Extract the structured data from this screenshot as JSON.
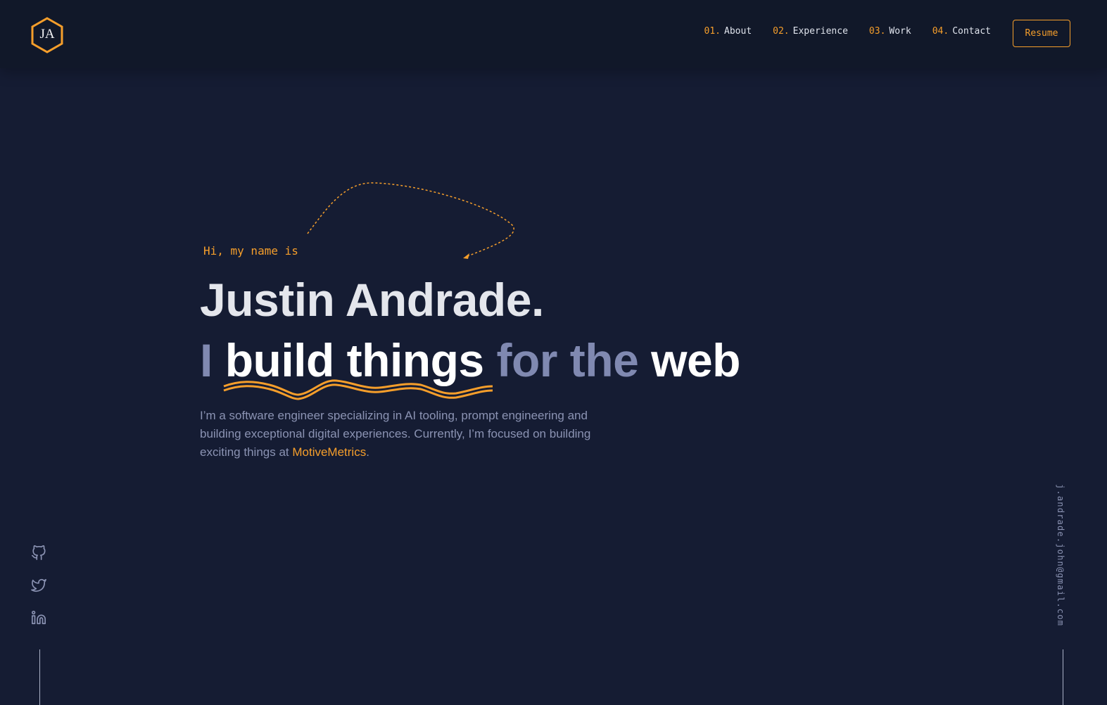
{
  "logo": {
    "initials": "JA"
  },
  "nav": {
    "items": [
      {
        "num": "01.",
        "label": "About"
      },
      {
        "num": "02.",
        "label": "Experience"
      },
      {
        "num": "03.",
        "label": "Work"
      },
      {
        "num": "04.",
        "label": "Contact"
      }
    ],
    "resume_label": "Resume"
  },
  "hero": {
    "greeting": "Hi, my name is",
    "name": "Justin Andrade.",
    "tagline": {
      "part1": "I",
      "part2": "build things",
      "part3": "for the",
      "part4": "web"
    },
    "description_before": "I’m a software engineer specializing in AI tooling, prompt engineering and building exceptional digital experiences. Currently, I’m focused on building exciting things at ",
    "description_link": "MotiveMetrics",
    "description_after": "."
  },
  "social": {
    "icons": [
      "github-icon",
      "twitter-icon",
      "linkedin-icon"
    ]
  },
  "email": "j.andrade.john@gmail.com",
  "colors": {
    "accent": "#f59e2b",
    "background": "#151c33",
    "header": "#111829",
    "muted_text": "#8089b1",
    "heading_text": "#e4e6ec"
  }
}
